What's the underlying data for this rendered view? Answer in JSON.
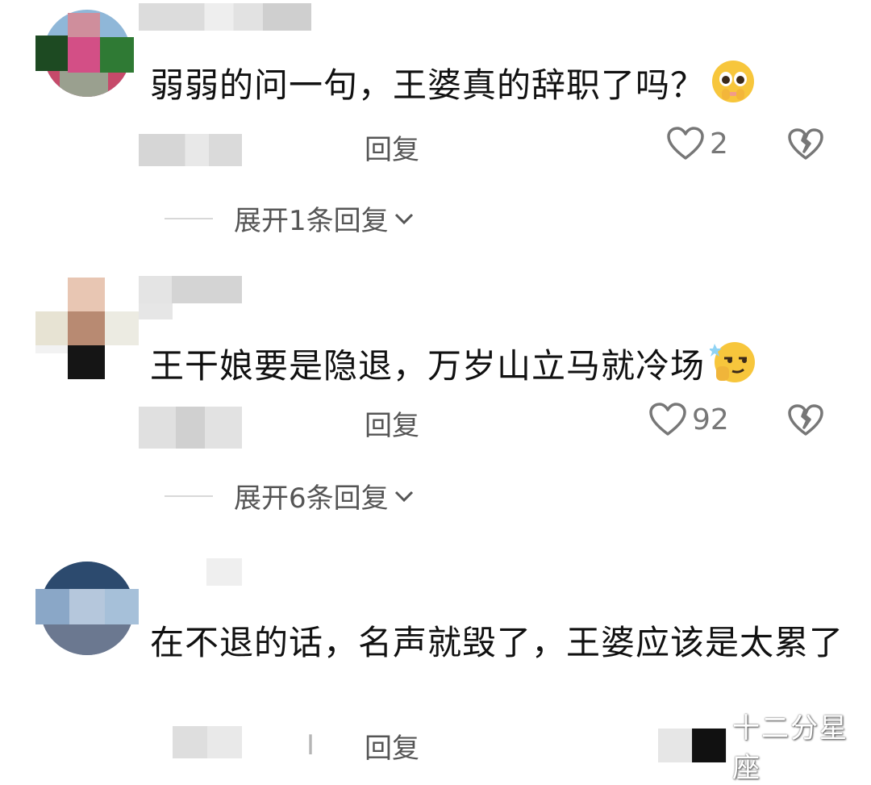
{
  "comments": [
    {
      "text": "弱弱的问一句，王婆真的辞职了吗？",
      "emoji": "pleading-face-emoji",
      "meta_char": "",
      "reply_label": "回复",
      "likes": "2",
      "expand_label": "展开1条回复"
    },
    {
      "text": "王干娘要是隐退，万岁山立马就冷场",
      "emoji": "smirking-face-emoji",
      "meta_char": "",
      "reply_label": "回复",
      "likes": "92",
      "expand_label": "展开6条回复"
    },
    {
      "text": "在不退的话，名声就毁了，王婆应该是太累了",
      "reply_label": "回复",
      "meta_char": "I"
    }
  ],
  "watermark": {
    "text": "十二分星座"
  },
  "colors": {
    "text": "#111111",
    "secondary": "#555555",
    "count": "#777777",
    "divider": "#d8d8d8"
  }
}
